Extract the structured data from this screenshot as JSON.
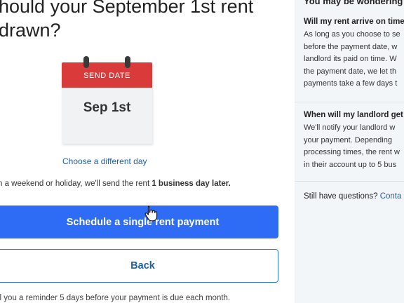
{
  "main": {
    "title_line1": "hould your September 1st rent",
    "title_line2": "drawn?",
    "calendar": {
      "header": "SEND DATE",
      "date": "Sep 1st"
    },
    "choose_day_link": "Choose a different day",
    "note_text": "n a weekend or holiday, we'll send the rent ",
    "note_bold": "1 business day later.",
    "primary_button": "Schedule a single rent payment",
    "back_button": "Back",
    "reminder_text": "il you a reminder 5 days before your payment is due each month."
  },
  "aside": {
    "heading": "You may be wondering",
    "faqs": [
      {
        "question": "Will my rent arrive on time",
        "answer_lines": [
          "As long as you choose to se",
          "before the payment date, w",
          "landlord its paid on time. W",
          "the payment date, we let th",
          "payments take a few days t"
        ]
      },
      {
        "question": "When will my landlord get",
        "answer_lines": [
          "We'll notify your landlord w",
          "your payment. Depending",
          "processing times, the rent w",
          "in their account up to 5 bus"
        ]
      }
    ],
    "still_questions": "Still have questions?",
    "contact_link": "Conta"
  },
  "colors": {
    "primary": "#2f6cf6",
    "link": "#1f5fa8",
    "calendar_header": "#d93a3a",
    "sidebar_bg": "#f3f6f9"
  },
  "icons": {
    "cursor": "hand-pointer-icon",
    "calendar": "calendar-icon"
  }
}
